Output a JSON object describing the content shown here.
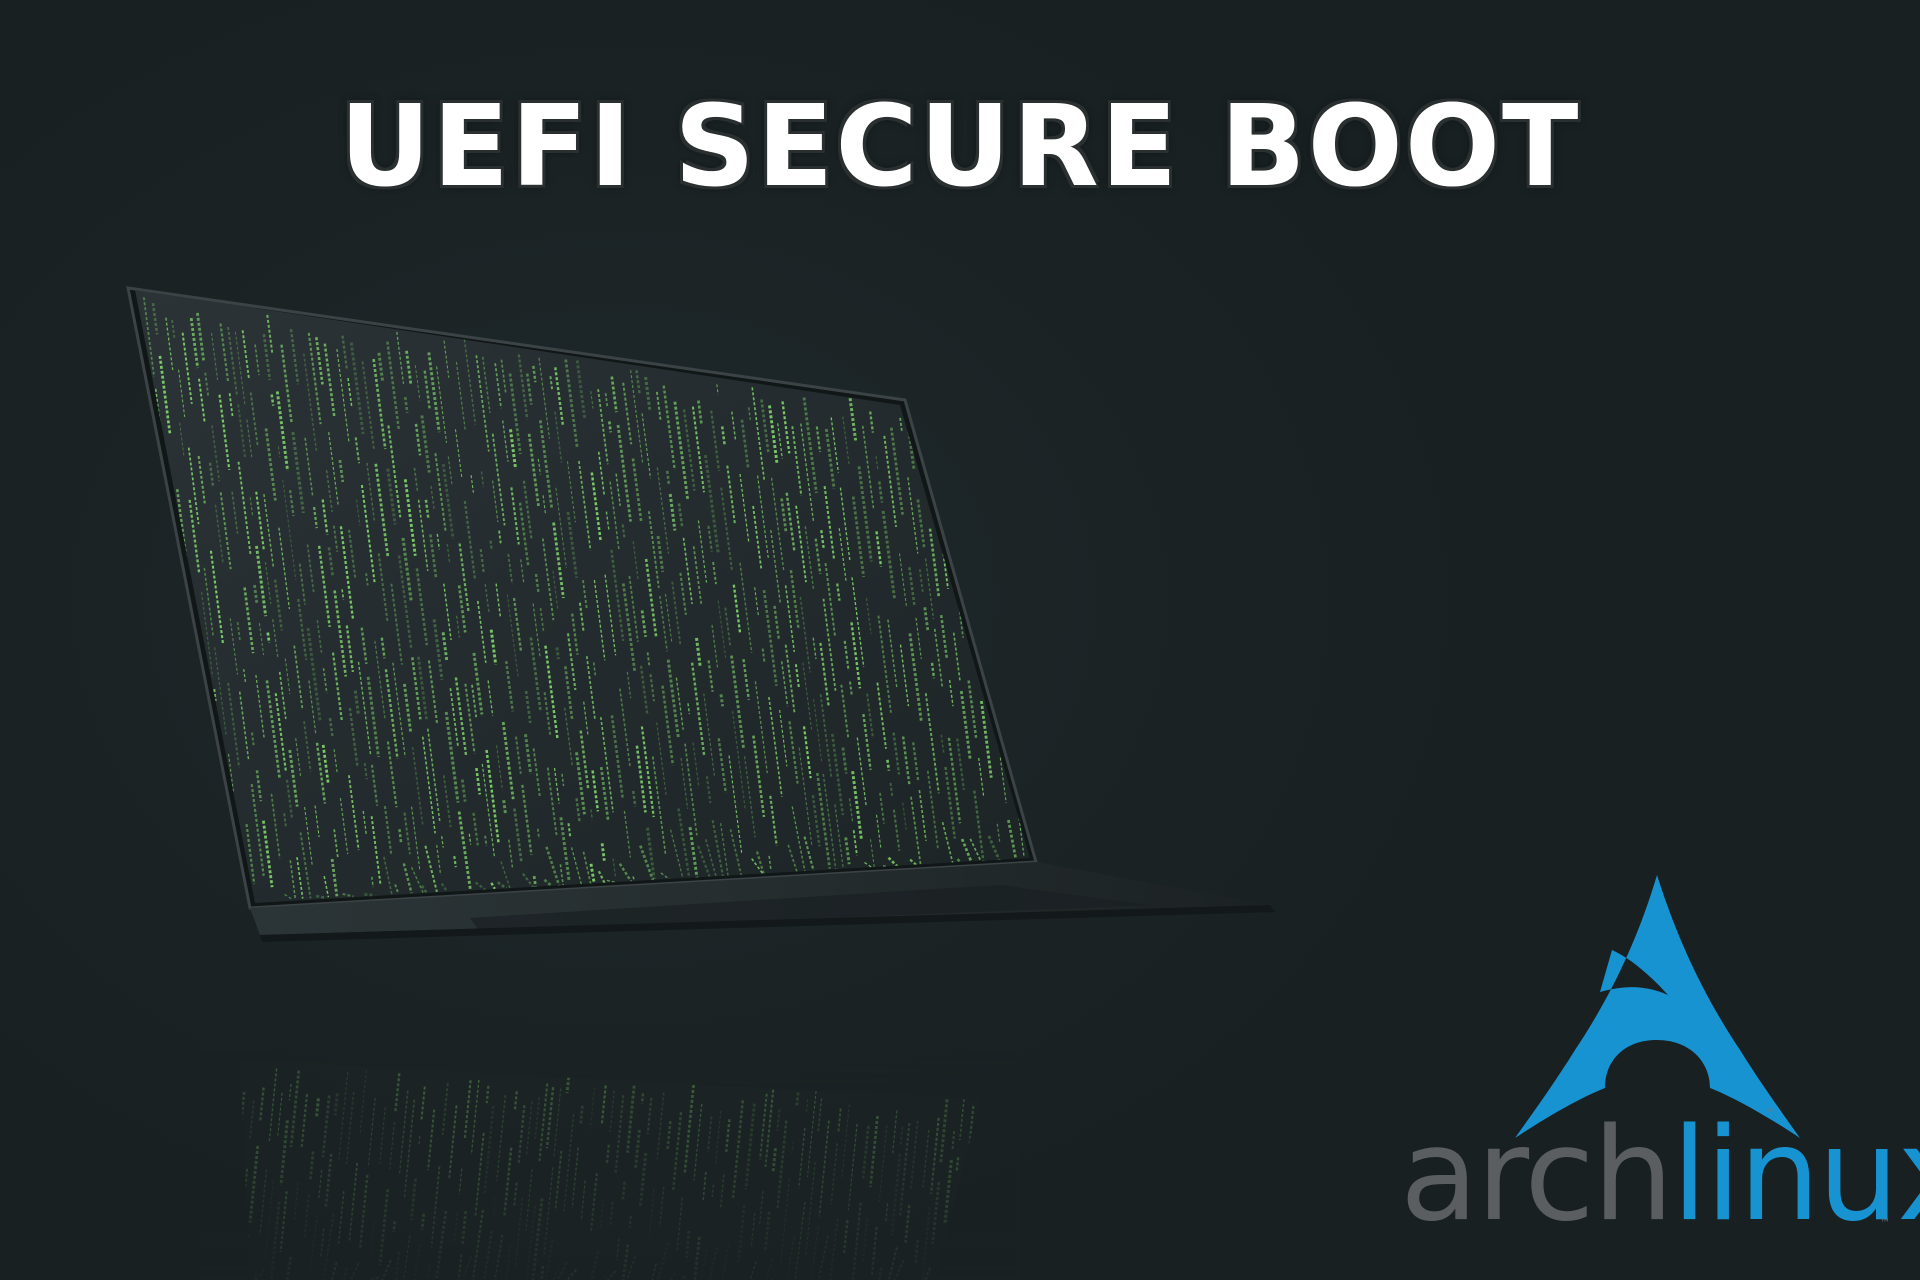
{
  "title": "UEFI SECURE BOOT",
  "logo": {
    "word_part_1": "arch",
    "word_part_2": "linux",
    "trademark": "™",
    "colors": {
      "arch": "#5b5e60",
      "linux": "#1793d1"
    }
  },
  "scene": {
    "subject": "laptop",
    "background_color": "#1b2224",
    "code_rain_color": "#7fd36a"
  }
}
